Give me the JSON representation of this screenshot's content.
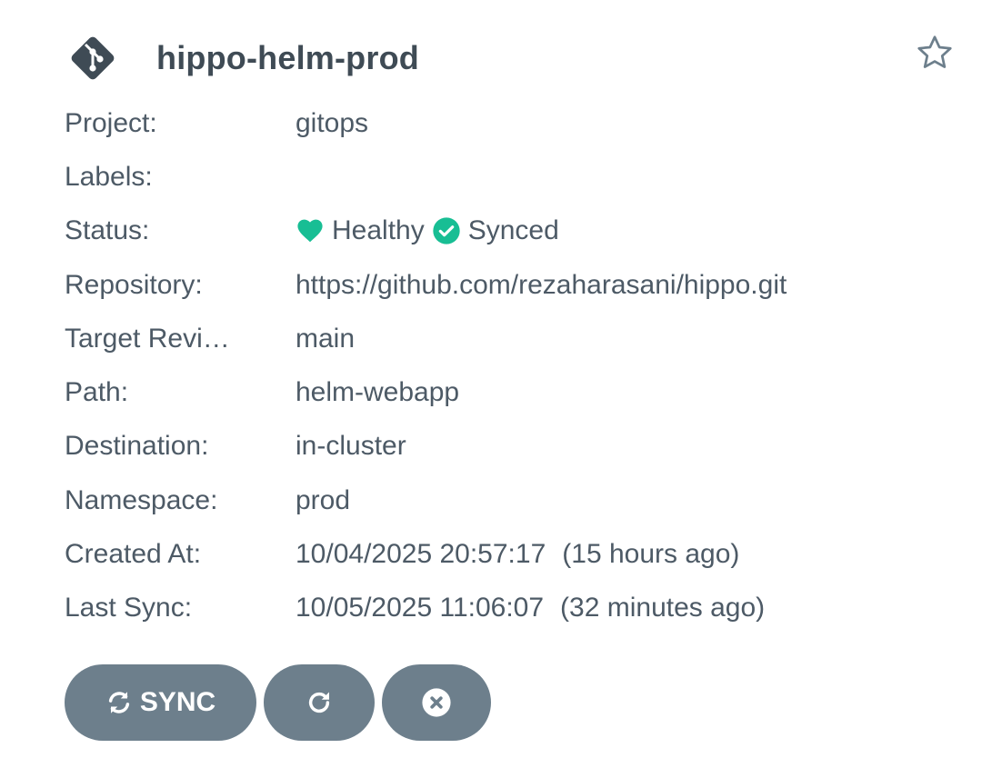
{
  "app": {
    "name": "hippo-helm-prod",
    "icon": "git-icon",
    "favorite_icon": "star-outline-icon"
  },
  "fields": {
    "project": {
      "label": "Project:",
      "value": "gitops"
    },
    "labels": {
      "label": "Labels:",
      "value": ""
    },
    "status": {
      "label": "Status:",
      "health": "Healthy",
      "health_icon": "heart-icon",
      "sync": "Synced",
      "sync_icon": "check-circle-icon"
    },
    "repository": {
      "label": "Repository:",
      "value": "https://github.com/rezaharasani/hippo.git"
    },
    "target_revision": {
      "label": "Target Revi…",
      "value": "main"
    },
    "path": {
      "label": "Path:",
      "value": "helm-webapp"
    },
    "destination": {
      "label": "Destination:",
      "value": "in-cluster"
    },
    "namespace": {
      "label": "Namespace:",
      "value": "prod"
    },
    "created_at": {
      "label": "Created At:",
      "date": "10/04/2025 20:57:17",
      "relative": "(15 hours ago)"
    },
    "last_sync": {
      "label": "Last Sync:",
      "date": "10/05/2025 11:06:07",
      "relative": "(32 minutes ago)"
    }
  },
  "actions": {
    "sync_label": "SYNC",
    "sync_icon": "sync-icon",
    "refresh_icon": "refresh-icon",
    "delete_icon": "close-circle-icon"
  },
  "colors": {
    "healthy": "#18be94",
    "synced": "#18be94",
    "button_bg": "#6d7f8c",
    "text": "#4d5a66",
    "title": "#3f4b55",
    "icon_dark": "#3f4b55"
  }
}
